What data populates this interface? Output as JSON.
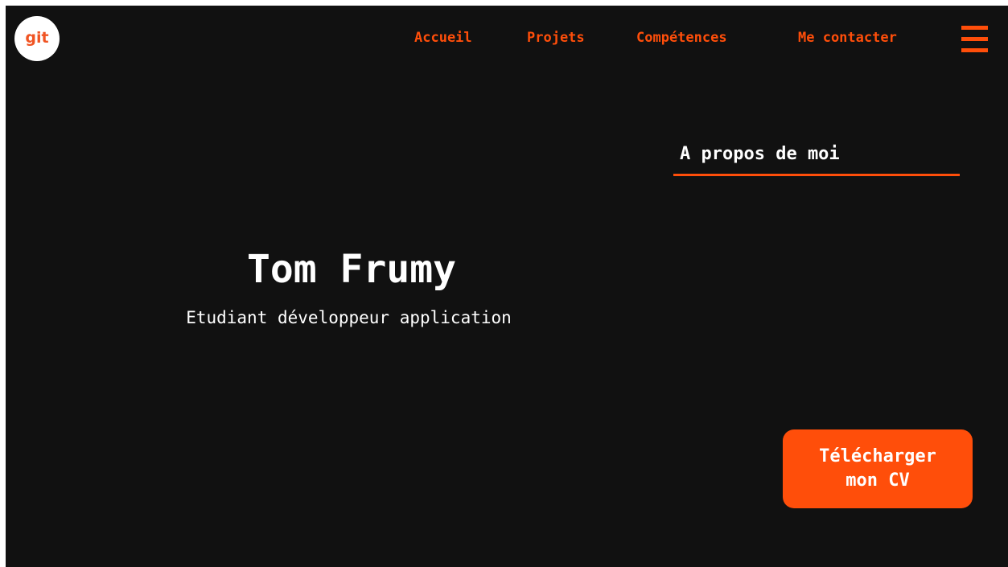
{
  "logo": {
    "text": "git"
  },
  "nav": {
    "items": [
      {
        "label": "Accueil"
      },
      {
        "label": "Projets"
      },
      {
        "label": "Compétences"
      },
      {
        "label": "Me contacter"
      }
    ],
    "menu_icon": "hamburger-menu-icon"
  },
  "about": {
    "title": "A propos de moi"
  },
  "hero": {
    "name": "Tom Frumy",
    "subtitle": "Etudiant développeur application"
  },
  "cv_button": {
    "line1": "Télécharger",
    "line2": "mon CV"
  },
  "colors": {
    "background": "#111111",
    "accent": "#ff4e0a",
    "text": "#ffffff"
  }
}
